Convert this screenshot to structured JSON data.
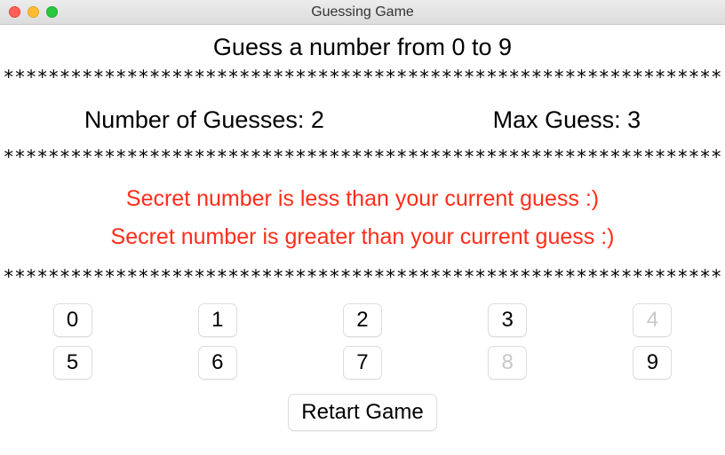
{
  "window": {
    "title": "Guessing Game"
  },
  "prompt": "Guess a number from 0 to 9",
  "divider": "****************************************************************",
  "stats": {
    "guesses_label": "Number of Guesses: ",
    "guesses_value": "2",
    "max_label": "Max Guess: ",
    "max_value": "3"
  },
  "hints": [
    "Secret number is less than your current guess :)",
    "Secret number is greater than your current guess :)"
  ],
  "numbers": [
    {
      "label": "0",
      "disabled": false
    },
    {
      "label": "1",
      "disabled": false
    },
    {
      "label": "2",
      "disabled": false
    },
    {
      "label": "3",
      "disabled": false
    },
    {
      "label": "4",
      "disabled": true
    },
    {
      "label": "5",
      "disabled": false
    },
    {
      "label": "6",
      "disabled": false
    },
    {
      "label": "7",
      "disabled": false
    },
    {
      "label": "8",
      "disabled": true
    },
    {
      "label": "9",
      "disabled": false
    }
  ],
  "restart_label": "Retart Game"
}
